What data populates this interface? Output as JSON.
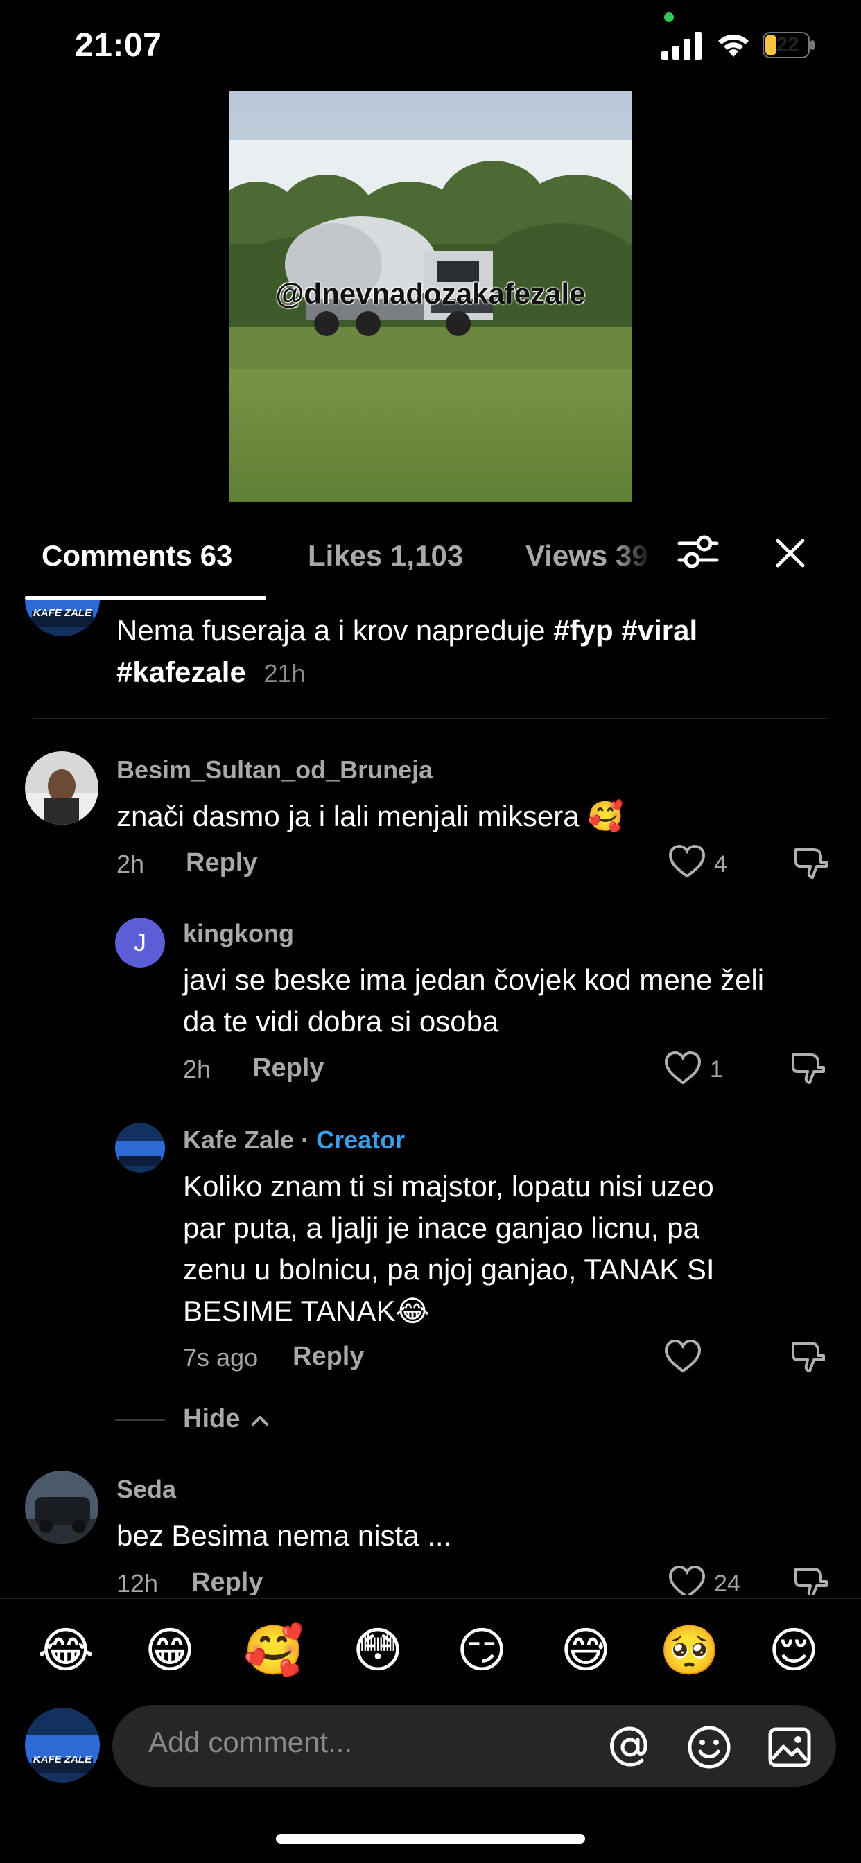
{
  "status_bar": {
    "time": "21:07",
    "battery": "22",
    "colors": {
      "active_dot": "#34c759",
      "battery_fill": "#f5c542"
    }
  },
  "video": {
    "watermark": "@dnevnadozakafezale"
  },
  "tabs": [
    {
      "label": "Comments 63",
      "active": true
    },
    {
      "label": "Likes 1,103",
      "active": false
    },
    {
      "label": "Views 39",
      "active": false
    }
  ],
  "icons": {
    "filter": "filter-sliders-icon",
    "close": "close-icon"
  },
  "caption": {
    "text": "Nema fuseraja a i krov napreduje",
    "hashtags": "#fyp #viral",
    "hashtag_line2": "#kafezale",
    "time": "21h",
    "avatar_text": "KAFE ZALE"
  },
  "comments": [
    {
      "username": "Besim_Sultan_od_Bruneja",
      "text": "znači dasmo ja i lali menjali miksera 🥰",
      "time": "2h",
      "reply_label": "Reply",
      "likes": "4"
    },
    {
      "username": "kingkong",
      "avatar_initial": "J",
      "text_line1": "javi se beske ima jedan čovjek kod mene želi",
      "text_line2": "da te vidi dobra si osoba",
      "time": "2h",
      "reply_label": "Reply",
      "likes": "1"
    },
    {
      "username": "Kafe Zale",
      "separator": " · ",
      "badge": "Creator",
      "avatar_text": "KAFE ZALE",
      "text_line1": "Koliko znam ti si majstor, lopatu nisi uzeo",
      "text_line2": "par puta, a ljalji je inace ganjao licnu, pa",
      "text_line3": "zenu u bolnicu, pa njoj ganjao, TANAK SI",
      "text_line4": "BESIME TANAK😂",
      "time": "7s ago",
      "reply_label": "Reply"
    },
    {
      "hide_label": "Hide"
    },
    {
      "username": "Seda",
      "text": "bez Besima nema nista ...",
      "time": "12h",
      "reply_label": "Reply",
      "likes": "24"
    }
  ],
  "emoji_bar": [
    "😂",
    "😁",
    "🥰",
    "😳",
    "😏",
    "😅",
    "🥺",
    "😌"
  ],
  "input": {
    "placeholder": "Add comment...",
    "avatar_text": "KAFE ZALE"
  }
}
